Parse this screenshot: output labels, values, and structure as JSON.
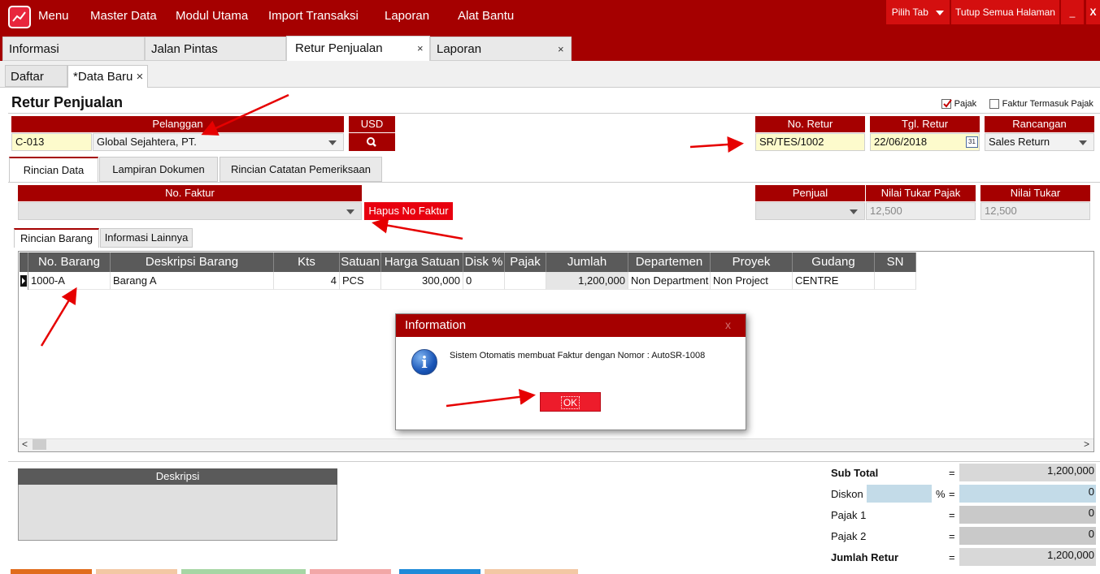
{
  "topbar": {
    "menu": [
      "Menu",
      "Master Data",
      "Modul Utama",
      "Import Transaksi",
      "Laporan",
      "Alat Bantu"
    ],
    "pilih_tab": "Pilih Tab",
    "tutup_semua": "Tutup Semua Halaman",
    "minimize": "_",
    "close": "X"
  },
  "main_tabs": [
    {
      "label": "Informasi"
    },
    {
      "label": "Jalan Pintas"
    },
    {
      "label": "Retur Penjualan",
      "close": "×"
    },
    {
      "label": "Laporan",
      "close": "×"
    }
  ],
  "sub_tabs": [
    {
      "label": "Daftar"
    },
    {
      "label": "*Data Baru",
      "close": "×"
    }
  ],
  "page_title": "Retur Penjualan",
  "checkboxes": {
    "pajak": {
      "label": "Pajak",
      "checked": true
    },
    "faktur_termasuk_pajak": {
      "label": "Faktur Termasuk Pajak",
      "checked": false
    }
  },
  "pelanggan": {
    "label": "Pelanggan",
    "code": "C-013",
    "name": "Global Sejahtera, PT."
  },
  "currency": {
    "label": "USD"
  },
  "no_retur": {
    "label": "No. Retur",
    "value": "SR/TES/1002"
  },
  "tgl_retur": {
    "label": "Tgl. Retur",
    "value": "22/06/2018",
    "calendar_day": "31"
  },
  "rancangan": {
    "label": "Rancangan",
    "value": "Sales Return"
  },
  "detail_tabs": [
    "Rincian Data",
    "Lampiran Dokumen",
    "Rincian Catatan Pemeriksaan"
  ],
  "no_faktur": {
    "label": "No. Faktur",
    "value": ""
  },
  "hapus_btn": "Hapus No Faktur",
  "penjual": {
    "label": "Penjual",
    "value": ""
  },
  "nilai_tukar_pajak": {
    "label": "Nilai Tukar Pajak",
    "value": "12,500"
  },
  "nilai_tukar": {
    "label": "Nilai Tukar",
    "value": "12,500"
  },
  "item_tabs": [
    "Rincian Barang",
    "Informasi Lainnya"
  ],
  "grid": {
    "columns": [
      "No. Barang",
      "Deskripsi Barang",
      "Kts",
      "Satuan",
      "Harga Satuan",
      "Disk %",
      "Pajak",
      "Jumlah",
      "Departemen",
      "Proyek",
      "Gudang",
      "SN"
    ],
    "rows": [
      [
        "1000-A",
        "Barang A",
        "4",
        "PCS",
        "300,000",
        "0",
        "",
        "1,200,000",
        "Non Department",
        "Non Project",
        "CENTRE",
        ""
      ]
    ],
    "scroll_left": "<",
    "scroll_right": ">"
  },
  "deskripsi": {
    "label": "Deskripsi"
  },
  "totals": {
    "sub_total": {
      "label": "Sub Total",
      "value": "1,200,000"
    },
    "diskon": {
      "label": "Diskon",
      "pct_sign": "%",
      "value": "0"
    },
    "pajak1": {
      "label": "Pajak 1",
      "value": "0"
    },
    "pajak2": {
      "label": "Pajak 2",
      "value": "0"
    },
    "jumlah_retur": {
      "label": "Jumlah Retur",
      "value": "1,200,000"
    },
    "eq": "="
  },
  "dialog": {
    "title": "Information",
    "close": "x",
    "icon": "i",
    "message": "Sistem Otomatis membuat Faktur dengan Nomor : AutoSR-1008",
    "ok": "OK"
  },
  "colors": {
    "brand": "#a50000",
    "accent": "#e8000f",
    "header_grey": "#5a5a5a"
  }
}
